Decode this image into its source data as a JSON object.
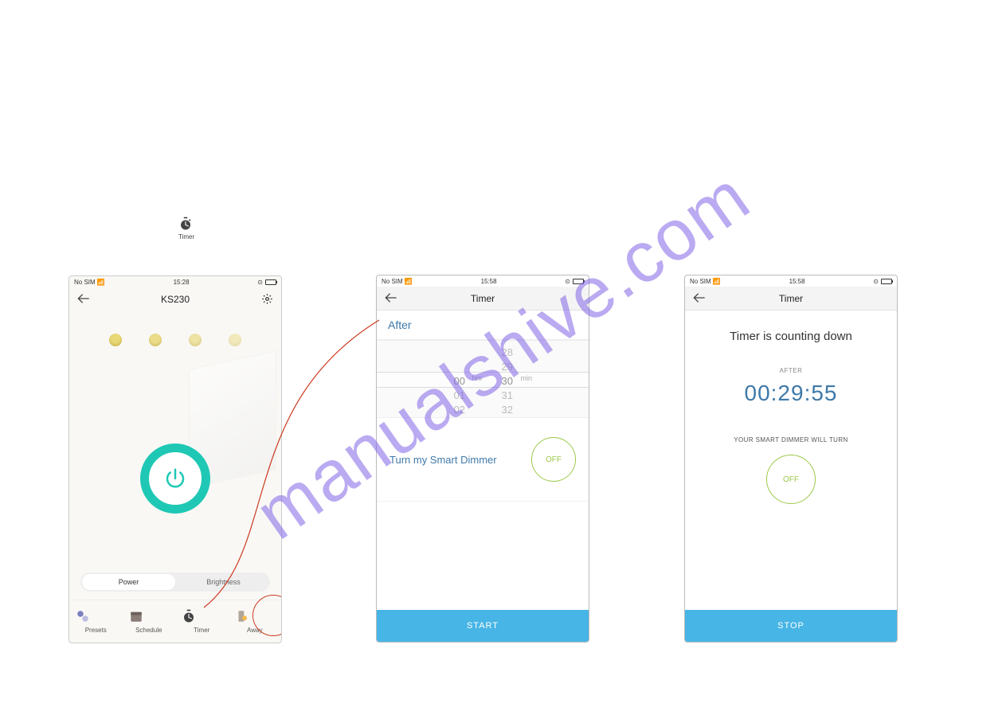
{
  "watermark": "manualshive.com",
  "intro_icon_label": "Timer",
  "phone1": {
    "status": {
      "carrier": "No SIM",
      "time": "15:28"
    },
    "title": "KS230",
    "segment": {
      "power": "Power",
      "brightness": "Brightness"
    },
    "tabs": {
      "presets": "Presets",
      "schedule": "Schedule",
      "timer": "Timer",
      "away": "Away"
    }
  },
  "phone2": {
    "status": {
      "carrier": "No SIM",
      "time": "15:58"
    },
    "title": "Timer",
    "after": "After",
    "picker": {
      "hrs_sel": "00",
      "hrs_unit": "hrs",
      "min_sel": "30",
      "min_unit": "min",
      "hrs_vals": [
        "00",
        "01",
        "02"
      ],
      "min_vals": [
        "28",
        "29",
        "30",
        "31",
        "32"
      ]
    },
    "turn_text": "Turn my Smart Dimmer",
    "off": "OFF",
    "start": "START"
  },
  "phone3": {
    "status": {
      "carrier": "No SIM",
      "time": "15:58"
    },
    "title": "Timer",
    "counting": "Timer is counting down",
    "after_label": "AFTER",
    "countdown": "00:29:55",
    "will_turn": "YOUR SMART DIMMER WILL TURN",
    "off": "OFF",
    "stop": "STOP"
  }
}
